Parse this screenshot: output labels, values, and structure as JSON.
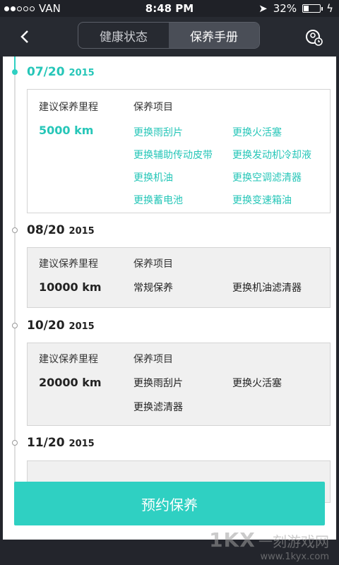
{
  "status_bar": {
    "carrier": "VAN",
    "time": "8:48 PM",
    "battery": "32%",
    "signal_dots_filled": 2,
    "signal_dots_total": 5
  },
  "nav": {
    "tabs": [
      {
        "label": "健康状态",
        "active": false
      },
      {
        "label": "保养手册",
        "active": true
      }
    ]
  },
  "schedule": [
    {
      "date": "07/20",
      "year": "2015",
      "active": true,
      "mileage_label": "建议保养里程",
      "items_label": "保养项目",
      "mileage": "5000  km",
      "items": [
        "更换雨刮片",
        "更换火活塞",
        "更换辅助传动皮带",
        "更换发动机冷却液",
        "更换机油",
        "更换空调滤清器",
        "更换蓄电池",
        "更换变速箱油"
      ]
    },
    {
      "date": "08/20",
      "year": "2015",
      "active": false,
      "mileage_label": "建议保养里程",
      "items_label": "保养项目",
      "mileage": "10000  km",
      "items": [
        "常规保养",
        "更换机油滤清器"
      ]
    },
    {
      "date": "10/20",
      "year": "2015",
      "active": false,
      "mileage_label": "建议保养里程",
      "items_label": "保养项目",
      "mileage": "20000  km",
      "items": [
        "更换雨刮片",
        "更换火活塞",
        "更换滤清器"
      ]
    },
    {
      "date": "11/20",
      "year": "2015",
      "active": false
    }
  ],
  "book_button": "预约保养",
  "watermark": {
    "logo": "1KX",
    "text": "一刻游戏网",
    "url": "www.1kyx.com"
  },
  "colors": {
    "accent": "#2fd0c2",
    "nav_bg": "#272a31"
  }
}
